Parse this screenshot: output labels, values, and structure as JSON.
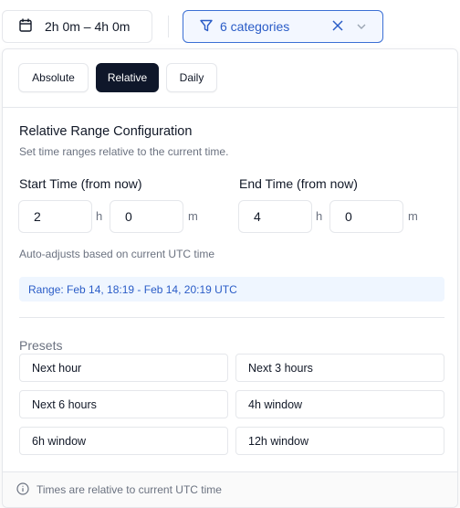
{
  "toolbar": {
    "date_range_label": "2h 0m – 4h 0m",
    "category_filter_label": "6 categories"
  },
  "tabs": [
    {
      "label": "Absolute",
      "active": false
    },
    {
      "label": "Relative",
      "active": true
    },
    {
      "label": "Daily",
      "active": false
    }
  ],
  "config": {
    "title": "Relative Range Configuration",
    "subtitle": "Set time ranges relative to the current time.",
    "start": {
      "label": "Start Time (from now)",
      "hours": "2",
      "minutes": "0"
    },
    "end": {
      "label": "End Time (from now)",
      "hours": "4",
      "minutes": "0"
    },
    "unit_hours": "h",
    "unit_minutes": "m",
    "auto_note": "Auto-adjusts based on current UTC time",
    "range_text": "Range: Feb 14, 18:19 - Feb 14, 20:19 UTC"
  },
  "presets": {
    "title": "Presets",
    "items": [
      "Next hour",
      "Next 3 hours",
      "Next 6 hours",
      "4h window",
      "6h window",
      "12h window"
    ]
  },
  "footer": {
    "text": "Times are relative to current UTC time"
  },
  "colors": {
    "accent": "#2a5cc7",
    "active_tab": "#0f172a",
    "range_bg": "#eff6ff"
  }
}
